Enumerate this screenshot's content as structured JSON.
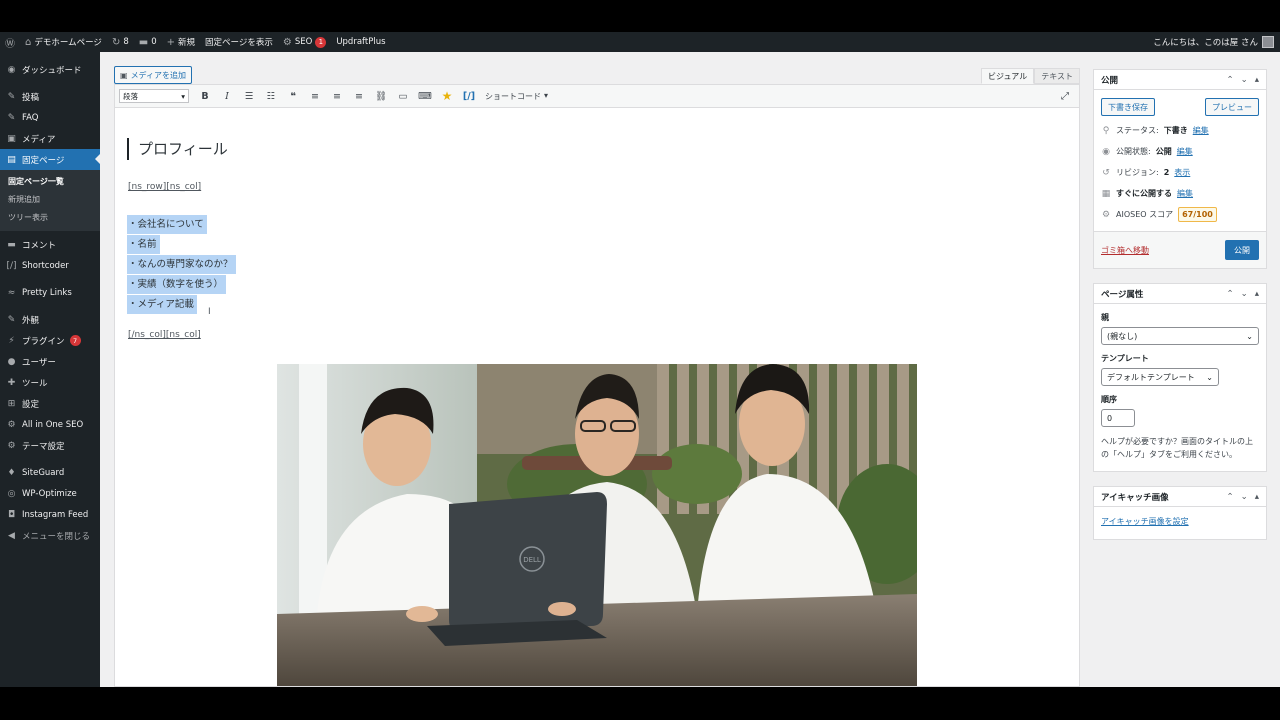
{
  "adminbar": {
    "site_name": "デモホームページ",
    "updates_count": "8",
    "comments_count": "0",
    "new_label": "新規",
    "view_page_label": "固定ページを表示",
    "seo_label": "SEO",
    "seo_badge": "1",
    "updraft_label": "UpdraftPlus",
    "greeting": "こんにちは、このは屋 さん"
  },
  "sidebar": {
    "dashboard": "ダッシュボード",
    "posts": "投稿",
    "faq": "FAQ",
    "media": "メディア",
    "pages": "固定ページ",
    "pages_sub": [
      "固定ページ一覧",
      "新規追加",
      "ツリー表示"
    ],
    "comments": "コメント",
    "shortcoder": "Shortcoder",
    "pretty_links": "Pretty Links",
    "appearance": "外観",
    "plugins": "プラグイン",
    "plugins_badge": "7",
    "users": "ユーザー",
    "tools": "ツール",
    "settings": "設定",
    "aioseo": "All in One SEO",
    "theme_settings": "テーマ設定",
    "siteguard": "SiteGuard",
    "wp_optimize": "WP-Optimize",
    "instagram_feed": "Instagram Feed",
    "collapse": "メニューを閉じる"
  },
  "editor": {
    "add_media": "メディアを追加",
    "tab_visual": "ビジュアル",
    "tab_text": "テキスト",
    "format_select": "段落",
    "shortcode_dropdown": "ショートコード",
    "heading": "プロフィール",
    "shortcode_open": "[ns_row][ns_col]",
    "list_items": [
      "・会社名について",
      "・名前",
      "・なんの専門家なのか？",
      "・実績（数字を使う）",
      "・メディア記載"
    ],
    "shortcode_close": "[/ns_col][ns_col]"
  },
  "publish_box": {
    "title": "公開",
    "save_draft": "下書き保存",
    "preview": "プレビュー",
    "status_label": "ステータス: ",
    "status_value": "下書き",
    "visibility_label": "公開状態: ",
    "visibility_value": "公開",
    "revisions_label": "リビジョン: ",
    "revisions_value": "2",
    "revisions_link": "表示",
    "schedule_label": "すぐに公開する",
    "edit_link": "編集",
    "aioseo_label": "AIOSEO スコア",
    "aioseo_score": "67/100",
    "trash": "ゴミ箱へ移動",
    "publish": "公開"
  },
  "attributes_box": {
    "title": "ページ属性",
    "parent_label": "親",
    "parent_value": "(親なし)",
    "template_label": "テンプレート",
    "template_value": "デフォルトテンプレート",
    "order_label": "順序",
    "order_value": "0",
    "help_text": "ヘルプが必要ですか？画面のタイトルの上の「ヘルプ」タブをご利用ください。"
  },
  "featured_box": {
    "title": "アイキャッチ画像",
    "set_link": "アイキャッチ画像を設定"
  },
  "photo": {
    "laptop_brand": "DELL"
  },
  "colors": {
    "admin_dark": "#1d2327",
    "accent_blue": "#2271b1",
    "selection": "#b5d4f5",
    "badge_red": "#d63638"
  }
}
